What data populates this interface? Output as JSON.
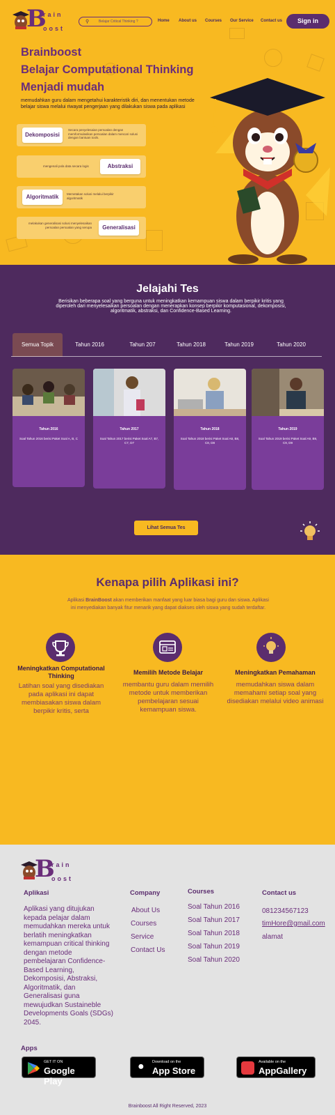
{
  "brand": {
    "logo_letter": "B",
    "logo_top": "rain",
    "logo_bottom": "oost"
  },
  "header": {
    "search_placeholder": "Belajar Critical Thinking ?",
    "nav": [
      "Home",
      "About us",
      "Courses",
      "Our Service",
      "Contact us"
    ],
    "signin": "Sign in"
  },
  "hero": {
    "line1": "Brainboost",
    "line2": "Belajar Computational Thinking",
    "line3": "Menjadi mudah",
    "desc": "memudahkan guru dalam mengetahui karakteristik diri, dan menentukan metode belajar siswa melalui riwayat pengerjaan yang dilakukan siswa pada aplikasi",
    "features": [
      {
        "label": "Dekomposisi",
        "text": "Secara penyelesaian persoalan dengan memformulasikan persoalan dalam mencari solusi dengan bantuan tools."
      },
      {
        "label": "Abstraksi",
        "text": "mengenali pola data secara logis"
      },
      {
        "label": "Algoritmatik",
        "text": "Memetakan solusi melalui berpikir algoritmatik"
      },
      {
        "label": "Generalisasi",
        "text": "melakukan generalisasi solusi menyelesaikan persoalan persoalan yang serupa"
      }
    ]
  },
  "tes": {
    "title": "Jelajahi Tes",
    "desc": "Berisikan beberapa soal yang berguna untuk meningkatkan kemampuan siswa dalam berpikir kritis yang diperoleh dari menyelesaikan persoalan dengan menerapkan konsep berpikir komputasional, dekomposisi, algoritmatik, abstraksi, dan Confidence-Based Learning.",
    "tabs": [
      "Semua Topik",
      "Tahun 2016",
      "Tahun 207",
      "Tahun 2018",
      "Tahun 2019",
      "Tahun 2020"
    ],
    "cards": [
      {
        "title": "Tahun 2016",
        "desc": "Soal Tahun 2016 berisi Paket Soal A, B, C"
      },
      {
        "title": "Tahun 2017",
        "desc": "Soal Tahun 2017 berisi Paket Soal A7, B7, C7, D7"
      },
      {
        "title": "Tahun 2018",
        "desc": "Soal Tahun 2018 berisi Paket Soal A8, B8, C8, D8"
      },
      {
        "title": "Tahun 2019",
        "desc": "Soal Tahun 2019 berisi Paket Soal A9, B9, C9, D9"
      }
    ],
    "button": "Lihat Semua Tes"
  },
  "kenapa": {
    "title": "Kenapa pilih Aplikasi ini?",
    "desc_pre": "Aplikasi ",
    "desc_brand": "BrainBoost",
    "desc_post": " akan memberikan manfaat yang luar biasa bagi guru dan siswa. Aplikasi ini menyediakan banyak fitur menarik yang dapat diakses oleh siswa yang sudah terdaftar.",
    "items": [
      {
        "title": "Meningkatkan Computational Thinking",
        "text": "Latihan soal yang disediakan pada aplikasi ini dapat membiasakan siswa dalam berpikir kritis, serta",
        "icon": "trophy-icon"
      },
      {
        "title": "Memilih Metode Belajar",
        "text": "membantu guru dalam memilih metode untuk memberikan pembelajaran sesuai kemampuan siswa.",
        "icon": "browser-icon"
      },
      {
        "title": "Meningkatkan Pemahaman",
        "text": "memudahkan siswa dalam memahami setiap soal yang disediakan melalui video animasi",
        "icon": "lightbulb-icon"
      }
    ]
  },
  "footer": {
    "aplikasi_title": "Aplikasi",
    "aplikasi_text": "Aplikasi yang ditujukan kepada pelajar dalam memudahkan mereka untuk berlatih meningkatkan kemampuan critical thinking dengan metode pembelajaran Confidence-Based Learning, Dekomposisi, Abstraksi, Algoritmatik, dan Generalisasi guna mewujudkan Sustaineble Developments Goals (SDGs) 2045.",
    "company_title": "Company",
    "company": [
      "About Us",
      "Courses",
      "Service",
      "Contact Us"
    ],
    "courses_title": "Courses",
    "courses": [
      "Soal Tahun 2016",
      "Soal Tahun 2017",
      "Soal Tahun 2018",
      "Soal Tahun 2019",
      "Soal Tahun 2020"
    ],
    "contact_title": "Contact us",
    "contact": [
      "081234567123",
      "timHore@gmail.com",
      "alamat"
    ],
    "apps_title": "Apps",
    "badges": [
      {
        "small": "GET IT ON",
        "large": "Google Play"
      },
      {
        "small": "Download on the",
        "large": "App Store"
      },
      {
        "small": "Available on the",
        "large": "AppGallery"
      }
    ],
    "copyright": "Brainboost All Right Reserved, 2023"
  },
  "colors": {
    "yellow": "#f8b921",
    "purple": "#4e2a5e",
    "accent": "#5b2d6e",
    "card": "#7a3d9a"
  }
}
